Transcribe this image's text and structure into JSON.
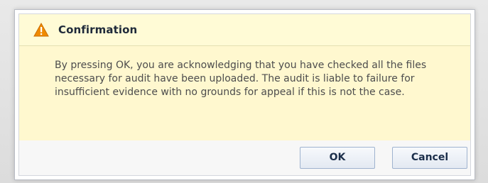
{
  "dialog": {
    "title": "Confirmation",
    "icon": "warning-icon",
    "message": "By pressing OK, you are acknowledging that you have checked all the files necessary for audit have been uploaded. The audit is liable to failure for insufficient evidence with no grounds for appeal if this is not the case.",
    "buttons": {
      "ok": "OK",
      "cancel": "Cancel"
    }
  },
  "colors": {
    "header_background": "#fffbd6",
    "message_background": "#fff8cf",
    "warning_icon": "#f08a00",
    "button_border": "#9fb3cf"
  }
}
